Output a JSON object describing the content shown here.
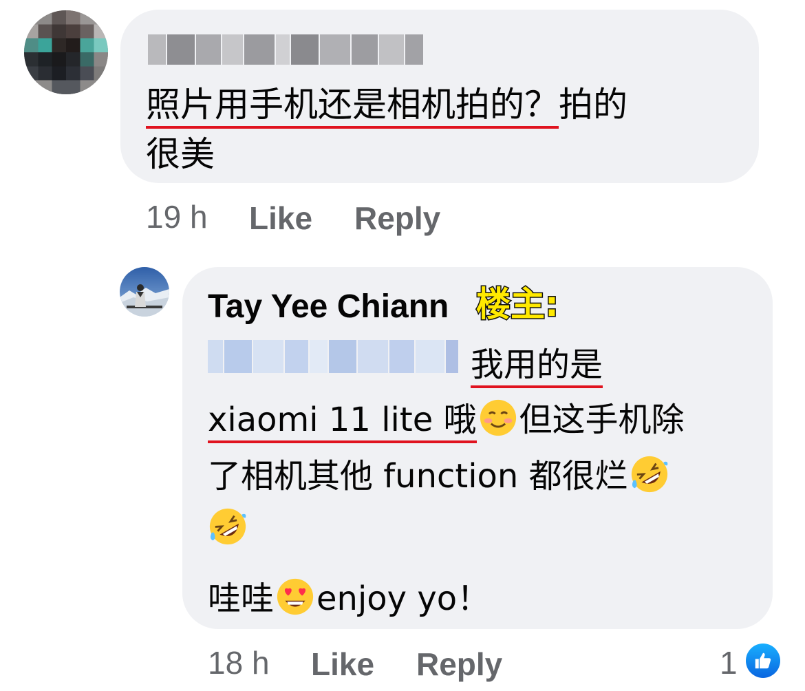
{
  "comment1": {
    "author_obscured": true,
    "text_line1_underlined": "照片用手机还是相机拍的？",
    "text_line1_rest": "拍的",
    "text_line2": "很美",
    "time": "19 h",
    "like_label": "Like",
    "reply_label": "Reply"
  },
  "comment2": {
    "author": "Tay Yee Chiann",
    "op_tag": "楼主:",
    "mention_obscured": true,
    "line1_underlined": "我用的是",
    "line2_underlined": "xiaomi 11 lite 哦",
    "line2_rest": "但这手机除",
    "line3": "了相机其他 function 都很烂",
    "line5_start": "哇哇",
    "line5_end": "enjoy yo！",
    "time": "18 h",
    "like_label": "Like",
    "reply_label": "Reply",
    "reaction_count": "1",
    "emojis": [
      "smiling-face-icon",
      "rolling-laughing-icon",
      "rolling-laughing-icon",
      "heart-eyes-icon"
    ]
  },
  "colors": {
    "bubble": "#f0f1f4",
    "underline": "#e0131f",
    "op_tag": "#ffe900",
    "meta_text": "#65676b",
    "like_blue": "#0a66e0"
  }
}
